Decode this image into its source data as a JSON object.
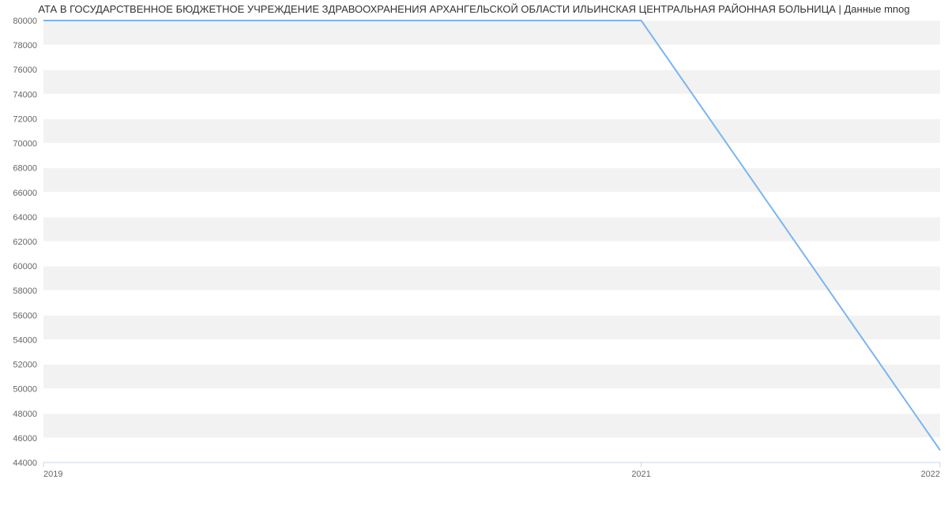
{
  "title": "АТА В ГОСУДАРСТВЕННОЕ БЮДЖЕТНОЕ УЧРЕЖДЕНИЕ ЗДРАВООХРАНЕНИЯ АРХАНГЕЛЬСКОЙ ОБЛАСТИ ИЛЬИНСКАЯ ЦЕНТРАЛЬНАЯ РАЙОННАЯ БОЛЬНИЦА | Данные mnog",
  "chart_data": {
    "type": "line",
    "x": [
      2019,
      2021,
      2022
    ],
    "values": [
      80000,
      80000,
      45000
    ],
    "title": "АТА В ГОСУДАРСТВЕННОЕ БЮДЖЕТНОЕ УЧРЕЖДЕНИЕ ЗДРАВООХРАНЕНИЯ АРХАНГЕЛЬСКОЙ ОБЛАСТИ ИЛЬИНСКАЯ ЦЕНТРАЛЬНАЯ РАЙОННАЯ БОЛЬНИЦА | Данные mnog",
    "xlabel": "",
    "ylabel": "",
    "ylim": [
      44000,
      80000
    ],
    "yticks": [
      44000,
      46000,
      48000,
      50000,
      52000,
      54000,
      56000,
      58000,
      60000,
      62000,
      64000,
      66000,
      68000,
      70000,
      72000,
      74000,
      76000,
      78000,
      80000
    ],
    "xticks": [
      2019,
      2021,
      2022
    ]
  }
}
